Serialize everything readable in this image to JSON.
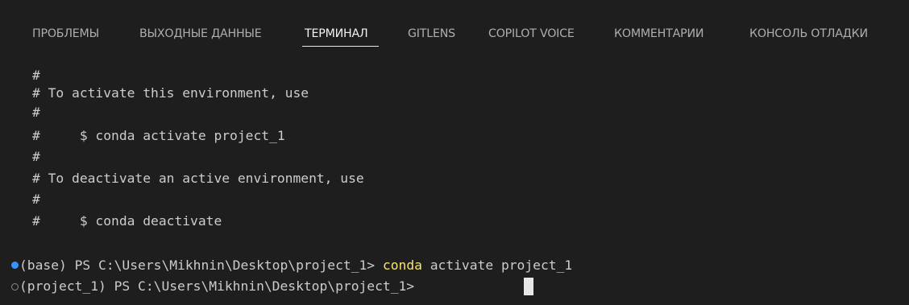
{
  "tabs": [
    {
      "label": "ПРОБЛЕМЫ",
      "active": false
    },
    {
      "label": "ВЫХОДНЫЕ ДАННЫЕ",
      "active": false
    },
    {
      "label": "ТЕРМИНАЛ",
      "active": true
    },
    {
      "label": "GITLENS",
      "active": false
    },
    {
      "label": "COPILOT VOICE",
      "active": false
    },
    {
      "label": "КОММЕНТАРИИ",
      "active": false
    },
    {
      "label": "КОНСОЛЬ ОТЛАДКИ",
      "active": false
    }
  ],
  "terminal": {
    "lines": [
      "#",
      "# To activate this environment, use",
      "#",
      "#     $ conda activate project_1",
      "#",
      "# To deactivate an active environment, use",
      "#",
      "#     $ conda deactivate"
    ],
    "prompt1": {
      "prefix": "(base) PS C:\\Users\\Mikhnin\\Desktop\\project_1> ",
      "command": "conda",
      "args": " activate project_1"
    },
    "prompt2": {
      "prefix": "(project_1) PS C:\\Users\\Mikhnin\\Desktop\\project_1> "
    }
  },
  "colors": {
    "background": "#1e1e1e",
    "text": "#cccccc",
    "active_tab": "#f2f2f2",
    "inactive_tab": "#aeaeae",
    "command_highlight": "#f6e56f",
    "success_marker": "#3794ff"
  }
}
